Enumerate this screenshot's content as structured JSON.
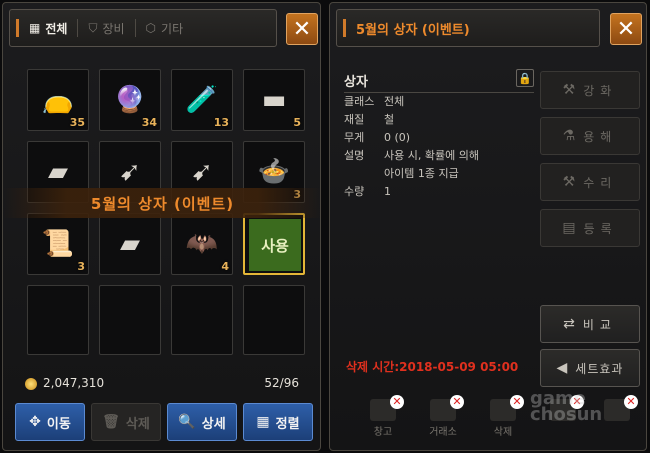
{
  "inventory": {
    "tabs": [
      {
        "label": "전체",
        "icon": "grid-icon",
        "active": true
      },
      {
        "label": "장비",
        "icon": "shield-icon",
        "active": false
      },
      {
        "label": "기타",
        "icon": "box-icon",
        "active": false
      }
    ],
    "slots": [
      {
        "name": "potion-bag",
        "qty": "35",
        "glyph": "👝"
      },
      {
        "name": "orb",
        "qty": "34",
        "glyph": "🔮"
      },
      {
        "name": "green-potion",
        "qty": "13",
        "glyph": "🧪"
      },
      {
        "name": "gold-bar",
        "qty": "5",
        "glyph": "▬"
      },
      {
        "name": "steel-ingot",
        "qty": "",
        "glyph": "▰"
      },
      {
        "name": "blue-scroll-1",
        "qty": "",
        "glyph": "➹"
      },
      {
        "name": "blue-scroll-2",
        "qty": "",
        "glyph": "➹"
      },
      {
        "name": "food-plate",
        "qty": "3",
        "glyph": "🍲"
      },
      {
        "name": "parchment",
        "qty": "3",
        "glyph": "📜"
      },
      {
        "name": "iron-bars",
        "qty": "",
        "glyph": "▰"
      },
      {
        "name": "leather-hide",
        "qty": "4",
        "glyph": "🦇"
      },
      {
        "name": "event-box",
        "qty": "",
        "glyph": "사용",
        "selected": true
      },
      {
        "name": "empty",
        "qty": "",
        "glyph": ""
      },
      {
        "name": "empty",
        "qty": "",
        "glyph": ""
      },
      {
        "name": "empty",
        "qty": "",
        "glyph": ""
      },
      {
        "name": "empty",
        "qty": "",
        "glyph": ""
      }
    ],
    "hover_banner": "5월의 상자 (이벤트)",
    "banner_qty_5": "5",
    "gold": "2,047,310",
    "capacity": "52/96",
    "buttons": {
      "move": "이동",
      "delete": "삭제",
      "detail": "상세",
      "sort": "정렬"
    }
  },
  "detail": {
    "title": "5월의 상자 (이벤트)",
    "header": "상자",
    "rows": [
      {
        "k": "클래스",
        "v": "전체"
      },
      {
        "k": "재질",
        "v": "철"
      },
      {
        "k": "무게",
        "v": "0 (0)"
      },
      {
        "k": "설명",
        "v": "사용 시, 확률에 의해"
      },
      {
        "k": "",
        "v": "아이템 1종 지급"
      },
      {
        "k": "수량",
        "v": "1"
      }
    ],
    "side_buttons": {
      "enhance": "강화",
      "dismantle": "용해",
      "repair": "수리",
      "register": "등록",
      "compare": "비교",
      "set_effect": "세트효과"
    },
    "expire": "삭제 시간:2018-05-09 05:00",
    "bottom_icons": {
      "storage": "창고",
      "trade": "거래소",
      "delete": "삭제"
    },
    "watermark": "game chosun"
  },
  "colors": {
    "accent_orange": "#ee8a2c",
    "expire_red": "#e0301e",
    "select_gold": "#e3b637",
    "blue_button": "#2e5fa9"
  }
}
